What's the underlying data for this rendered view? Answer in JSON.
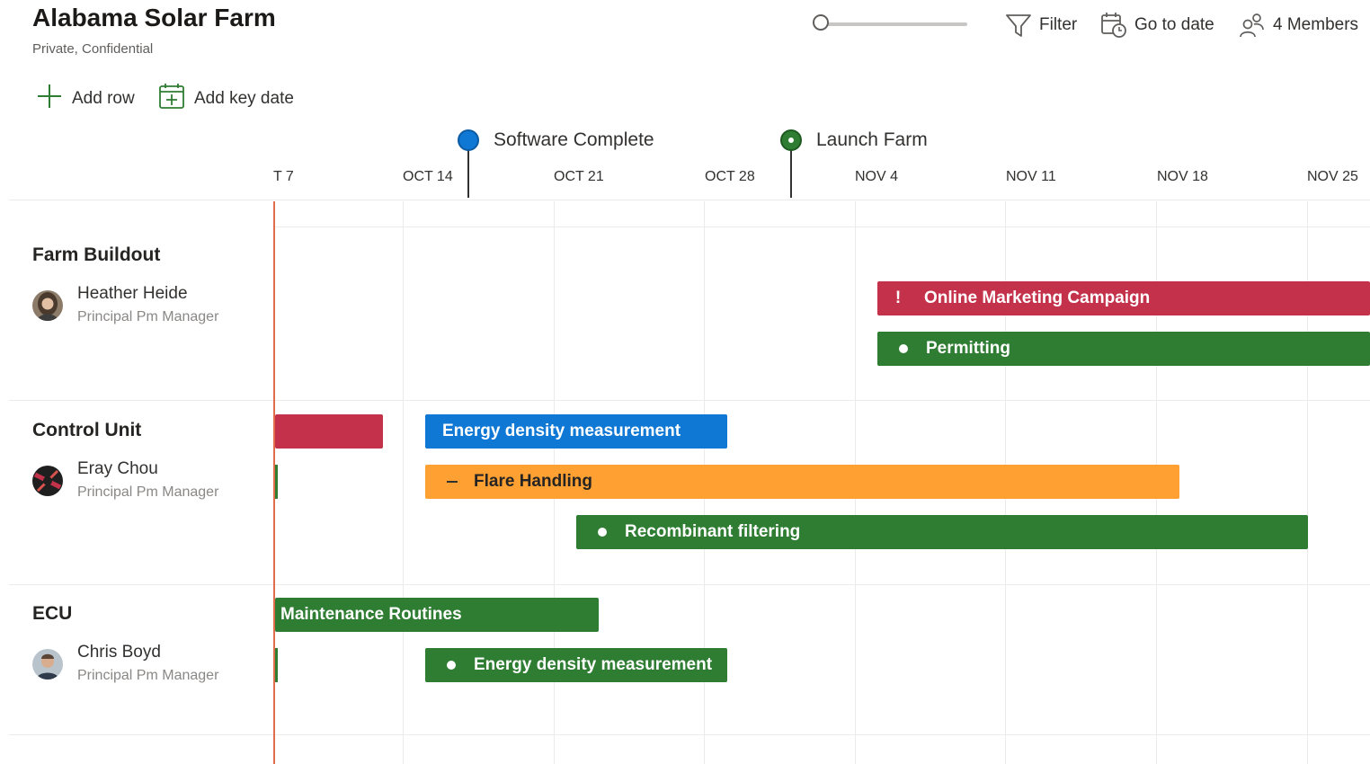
{
  "header": {
    "title": "Alabama Solar Farm",
    "subtitle": "Private, Confidential"
  },
  "toolbar": {
    "zoom_slider_value": 0,
    "filter_label": "Filter",
    "goto_label": "Go to date",
    "members_label": "4 Members"
  },
  "actions": {
    "add_row_label": "Add row",
    "add_key_date_label": "Add key date"
  },
  "colors": {
    "red": "#c4314b",
    "green": "#2e7d32",
    "blue": "#0f78d4",
    "orange": "#ffa033",
    "today_line": "#e06c4b"
  },
  "milestones": [
    {
      "label": "Software Complete",
      "color": "#0f78d4"
    },
    {
      "label": "Launch Farm",
      "color": "#2e7d32"
    }
  ],
  "timeline": {
    "dates": [
      "T 7",
      "OCT 14",
      "OCT 21",
      "OCT 28",
      "NOV 4",
      "NOV 11",
      "NOV 18",
      "NOV 25"
    ]
  },
  "groups": [
    {
      "name": "Farm Buildout",
      "person": "Heather Heide",
      "role": "Principal Pm Manager",
      "tasks": [
        {
          "label": "Online Marketing Campaign",
          "icon": "!",
          "color": "#c4314b"
        },
        {
          "label": "Permitting",
          "icon": "dot",
          "color": "#2e7d32"
        }
      ]
    },
    {
      "name": "Control Unit",
      "person": "Eray Chou",
      "role": "Principal Pm Manager",
      "tasks": [
        {
          "label": "",
          "icon": "",
          "color": "#c4314b"
        },
        {
          "label": "Energy density measurement",
          "icon": "",
          "color": "#0f78d4"
        },
        {
          "label": "Flare Handling",
          "icon": "dash",
          "color": "#ffa033"
        },
        {
          "label": "Recombinant filtering",
          "icon": "dot",
          "color": "#2e7d32"
        }
      ]
    },
    {
      "name": "ECU",
      "person": "Chris Boyd",
      "role": "Principal Pm Manager",
      "tasks": [
        {
          "label": "Maintenance Routines",
          "icon": "",
          "color": "#2e7d32"
        },
        {
          "label": "Energy density measurement",
          "icon": "dot",
          "color": "#2e7d32"
        }
      ]
    }
  ]
}
